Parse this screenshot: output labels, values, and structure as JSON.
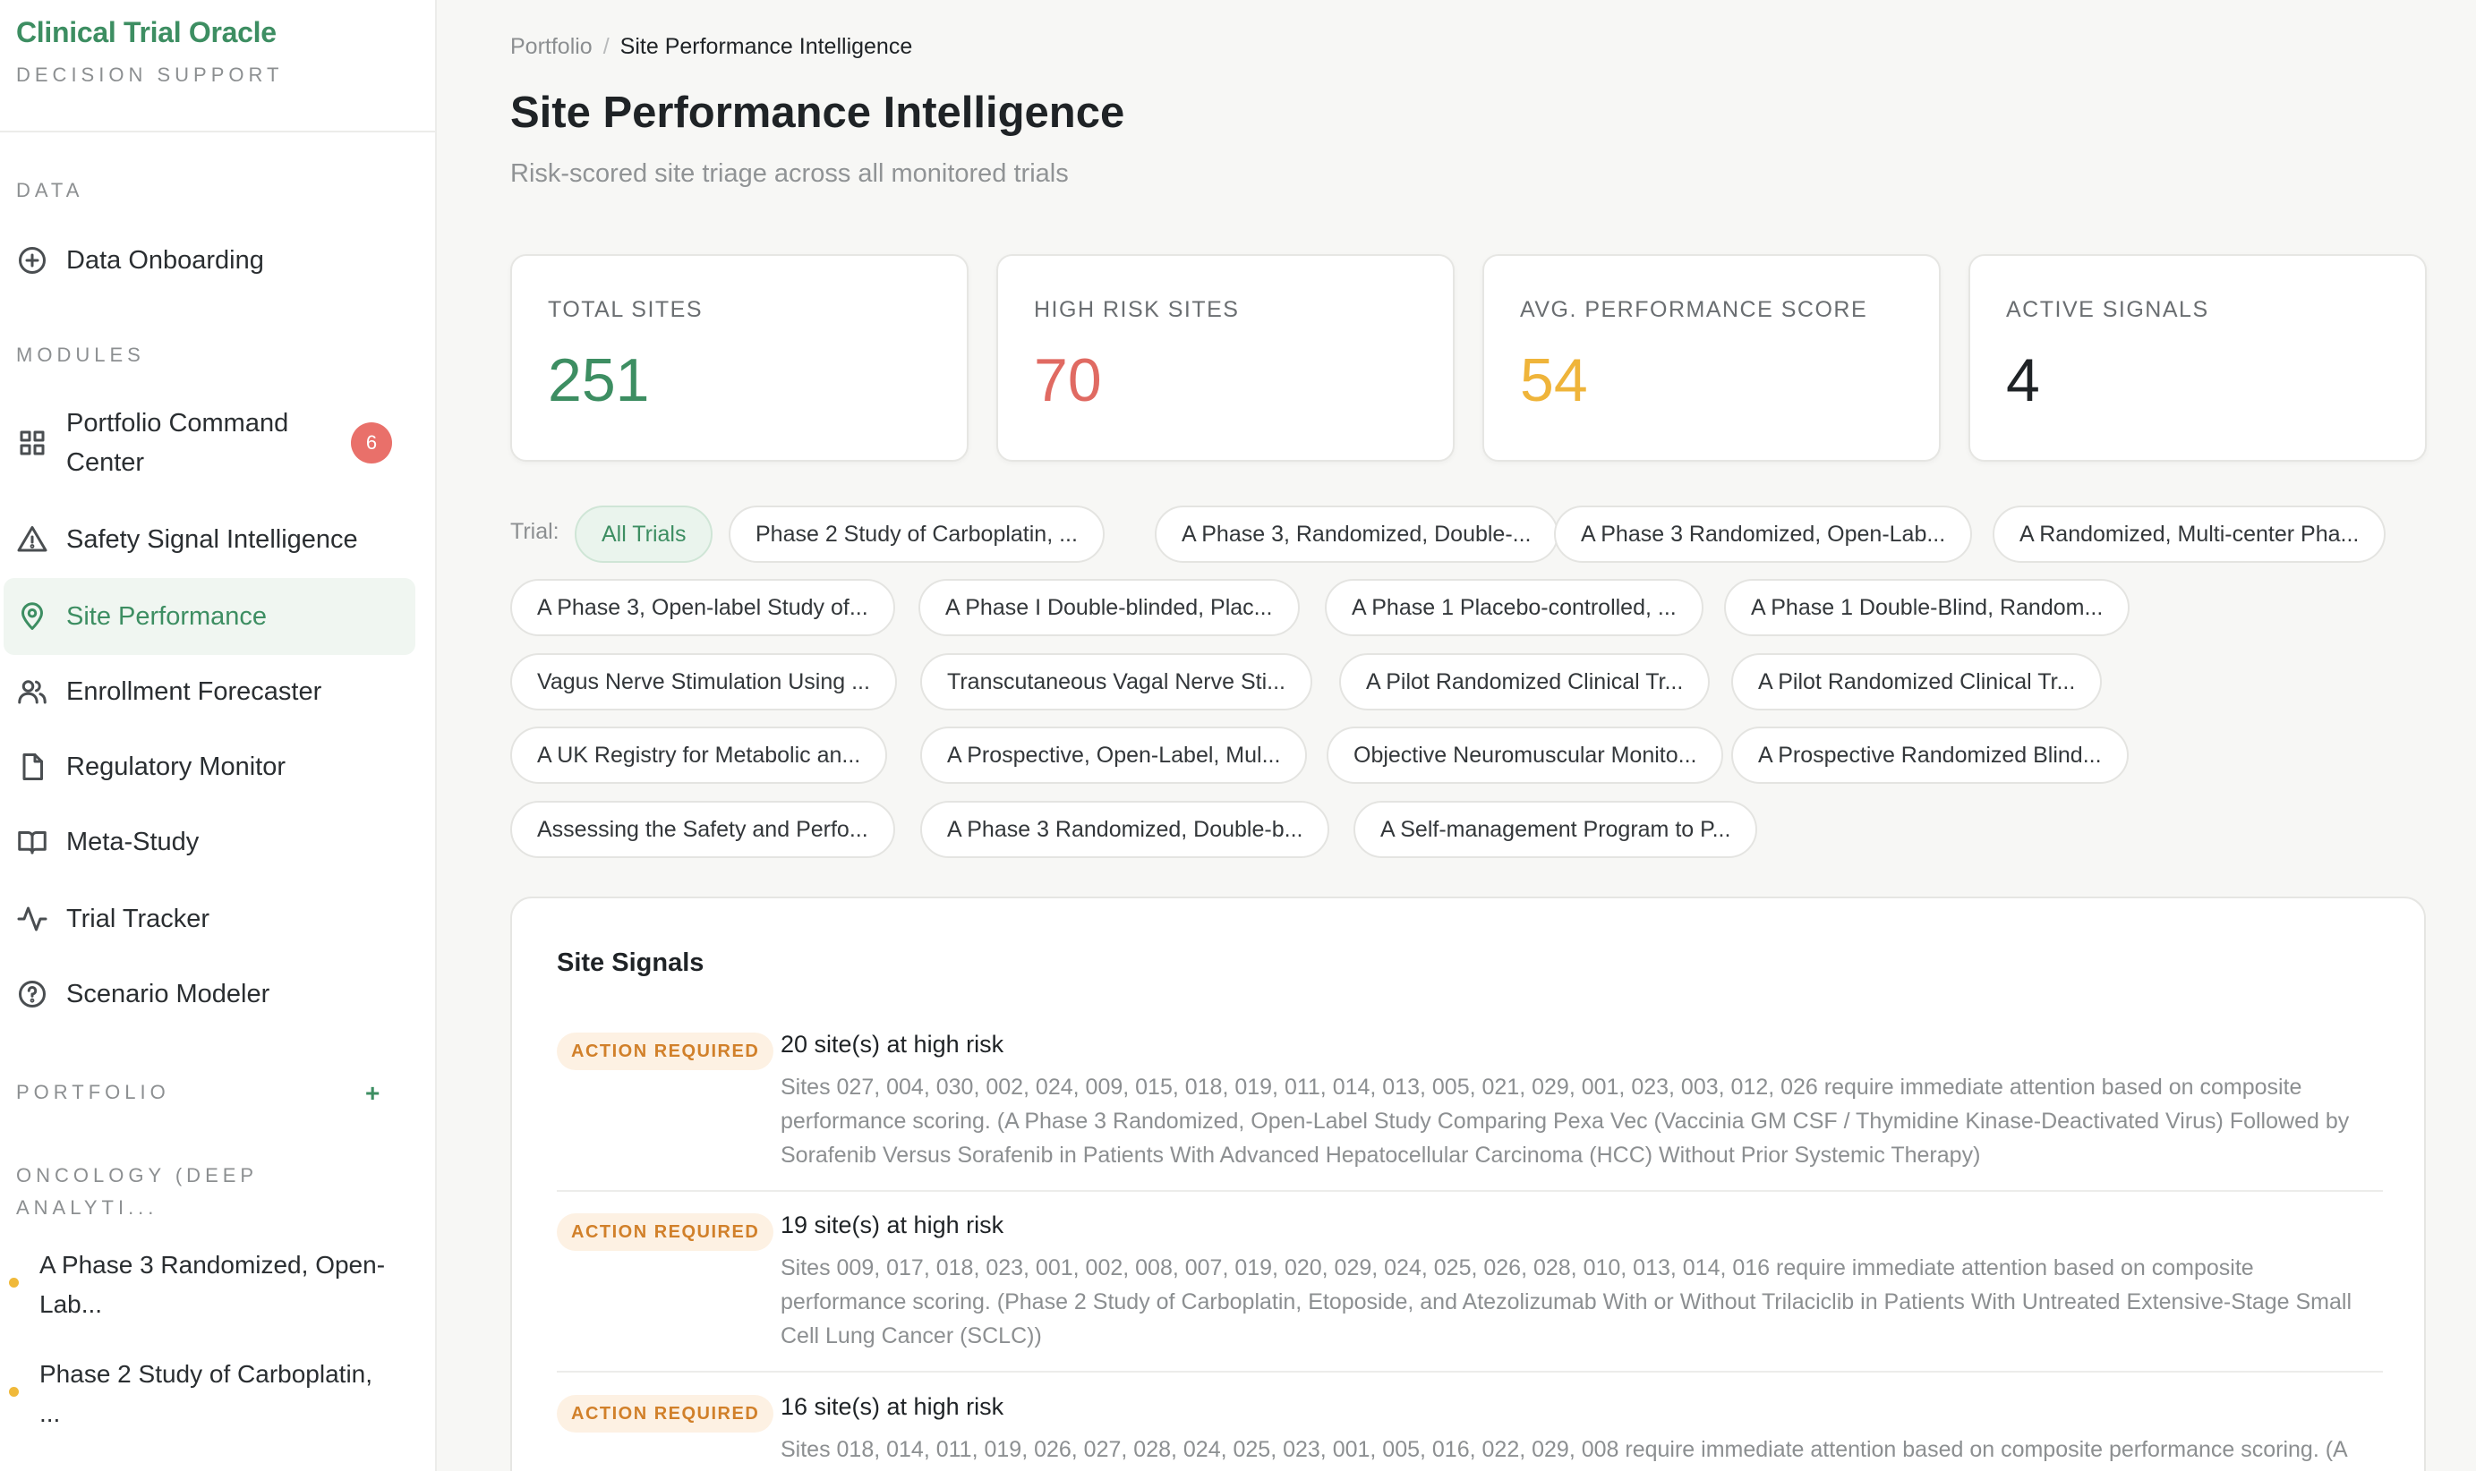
{
  "brand": {
    "title": "Clinical Trial Oracle",
    "subtitle": "DECISION SUPPORT"
  },
  "sidebar": {
    "data_label": "DATA",
    "data_items": [
      {
        "label": "Data Onboarding",
        "icon": "plus-circle-icon"
      }
    ],
    "modules_label": "MODULES",
    "modules": [
      {
        "label": "Portfolio Command Center",
        "icon": "grid-icon",
        "badge": "6"
      },
      {
        "label": "Safety Signal Intelligence",
        "icon": "warning-triangle-icon"
      },
      {
        "label": "Site Performance",
        "icon": "map-pin-icon",
        "active": true
      },
      {
        "label": "Enrollment Forecaster",
        "icon": "users-icon"
      },
      {
        "label": "Regulatory Monitor",
        "icon": "document-icon"
      },
      {
        "label": "Meta-Study",
        "icon": "book-icon"
      },
      {
        "label": "Trial Tracker",
        "icon": "activity-icon"
      },
      {
        "label": "Scenario Modeler",
        "icon": "help-circle-icon"
      }
    ],
    "portfolio_label": "PORTFOLIO",
    "portfolio_add": "+",
    "portfolio_group": "ONCOLOGY (DEEP ANALYTI...",
    "portfolio_items": [
      {
        "label": "A Phase 3 Randomized, Open-Lab..."
      },
      {
        "label": "Phase 2 Study of Carboplatin, ..."
      }
    ]
  },
  "breadcrumb": {
    "root": "Portfolio",
    "separator": "/",
    "current": "Site Performance Intelligence"
  },
  "page": {
    "title": "Site Performance Intelligence",
    "subtitle": "Risk-scored site triage across all monitored trials"
  },
  "stats": [
    {
      "label": "TOTAL SITES",
      "value": "251",
      "color": "#3d8e62"
    },
    {
      "label": "HIGH RISK SITES",
      "value": "70",
      "color": "#e06a62"
    },
    {
      "label": "AVG. PERFORMANCE SCORE",
      "value": "54",
      "color": "#efb43a"
    },
    {
      "label": "ACTIVE SIGNALS",
      "value": "4",
      "color": "#1f2326"
    }
  ],
  "filter": {
    "label": "Trial:",
    "chips": [
      "All Trials",
      "Phase 2 Study of Carboplatin, ...",
      "A Phase 3, Randomized, Double-...",
      "A Phase 3 Randomized, Open-Lab...",
      "A Randomized, Multi-center Pha...",
      "A Phase 3, Open-label Study of...",
      "A Phase I Double-blinded, Plac...",
      "A Phase 1 Placebo-controlled, ...",
      "A Phase 1 Double-Blind, Random...",
      "Vagus Nerve Stimulation Using ...",
      "Transcutaneous Vagal Nerve Sti...",
      "A Pilot Randomized Clinical Tr...",
      "A Pilot Randomized Clinical Tr...",
      "A UK Registry for Metabolic an...",
      "A Prospective, Open-Label, Mul...",
      "Objective Neuromuscular Monito...",
      "A Prospective Randomized Blind...",
      "Assessing the Safety and Perfo...",
      "A Phase 3 Randomized, Double-b...",
      "A Self-management Program to P..."
    ]
  },
  "signals": {
    "title": "Site Signals",
    "items": [
      {
        "status": "ACTION REQUIRED",
        "heading": "20 site(s) at high risk",
        "body": "Sites 027, 004, 030, 002, 024, 009, 015, 018, 019, 011, 014, 013, 005, 021, 029, 001, 023, 003, 012, 026 require immediate attention based on composite performance scoring. (A Phase 3 Randomized, Open-Label Study Comparing Pexa Vec (Vaccinia GM CSF / Thymidine Kinase-Deactivated Virus) Followed by Sorafenib Versus Sorafenib in Patients With Advanced Hepatocellular Carcinoma (HCC) Without Prior Systemic Therapy)"
      },
      {
        "status": "ACTION REQUIRED",
        "heading": "19 site(s) at high risk",
        "body": "Sites 009, 017, 018, 023, 001, 002, 008, 007, 019, 020, 029, 024, 025, 026, 028, 010, 013, 014, 016 require immediate attention based on composite performance scoring. (Phase 2 Study of Carboplatin, Etoposide, and Atezolizumab With or Without Trilaciclib in Patients With Untreated Extensive-Stage Small Cell Lung Cancer (SCLC))"
      },
      {
        "status": "ACTION REQUIRED",
        "heading": "16 site(s) at high risk",
        "body": "Sites 018, 014, 011, 019, 026, 027, 028, 024, 025, 023, 001, 005, 016, 022, 029, 008 require immediate attention based on composite performance scoring. (A"
      }
    ]
  }
}
